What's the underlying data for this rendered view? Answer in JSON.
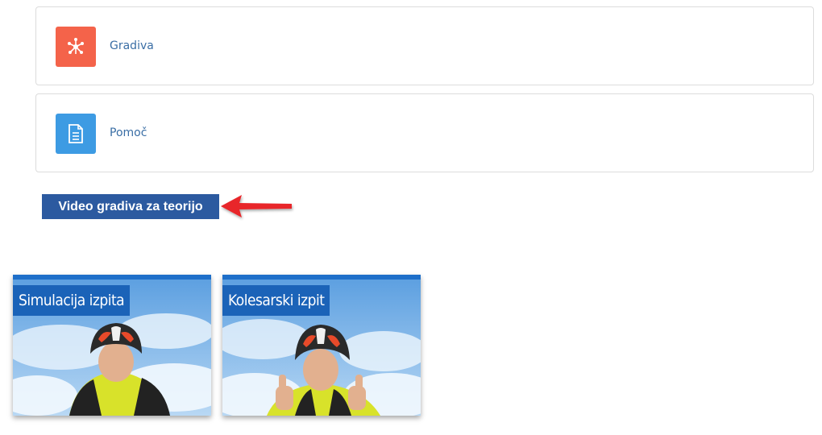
{
  "cards": [
    {
      "label": "Gradiva",
      "icon": "network-hub-icon",
      "color": "#f4634a"
    },
    {
      "label": "Pomoč",
      "icon": "document-icon",
      "color": "#3d9be3"
    }
  ],
  "video_button": {
    "label": "Video gradiva za teorijo"
  },
  "videos": [
    {
      "title": "Simulacija izpita"
    },
    {
      "title": "Kolesarski izpit"
    }
  ],
  "colors": {
    "video_button_bg": "#2c5aa0",
    "arrow": "#e8282b",
    "thumb_tag": "#1b63b8"
  }
}
